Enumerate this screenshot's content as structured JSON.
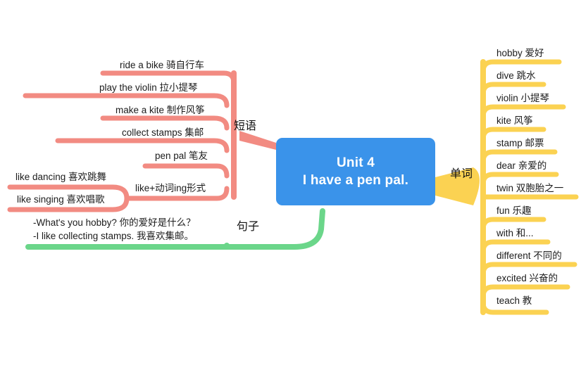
{
  "center": {
    "title_line1": "Unit 4",
    "title_line2": "I have a pen pal.",
    "color": "#3a93ea"
  },
  "branches": {
    "phrases": {
      "label": "短语",
      "color": "#f28b82",
      "items": [
        "ride a bike 骑自行车",
        "play the violin 拉小提琴",
        "make a kite 制作风筝",
        "collect stamps 集邮",
        "pen pal 笔友",
        "like+动词ing形式"
      ],
      "sub_items": [
        "like dancing 喜欢跳舞",
        "like singing 喜欢唱歌"
      ]
    },
    "words": {
      "label": "单词",
      "color": "#fbd252",
      "items": [
        "hobby 爱好",
        "dive 跳水",
        "violin 小提琴",
        "kite 风筝",
        "stamp 邮票",
        "dear 亲爱的",
        "twin 双胞胎之一",
        "fun 乐趣",
        "with 和...",
        "different 不同的",
        "excited 兴奋的",
        "teach 教"
      ]
    },
    "sentences": {
      "label": "句子",
      "color": "#6bd68a",
      "lines": [
        "-What's you hobby? 你的爱好是什么？",
        "-I like collecting stamps. 我喜欢集邮。"
      ]
    }
  }
}
